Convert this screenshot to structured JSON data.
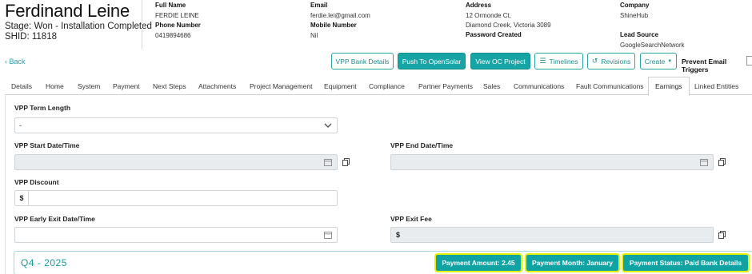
{
  "customer": {
    "name": "Ferdinand Leine",
    "stage": "Stage: Won - Installation Completed",
    "shid": "SHID: 11818"
  },
  "details": {
    "full_name_label": "Full Name",
    "full_name": "FERDIE LEINE",
    "phone_label": "Phone Number",
    "phone": "0419894686",
    "email_label": "Email",
    "email": "ferdie.lei@gmail.com",
    "mobile_label": "Mobile Number",
    "mobile": "Nil",
    "address_label": "Address",
    "address_line1": "12 Ormonde Ct,",
    "address_line2": "Diamond Creek, Victoria 3089",
    "password_label": "Password Created",
    "company_label": "Company",
    "company": "ShineHub",
    "lead_source_label": "Lead Source",
    "lead_source": "GoogleSearchNetwork"
  },
  "toolbar": {
    "back": "Back",
    "vpp_bank_details": "VPP Bank Details",
    "push_opensolar": "Push To OpenSolar",
    "view_oc_project": "View OC Project",
    "timelines": "Timelines",
    "revisions": "Revisions",
    "create": "Create",
    "prevent_email_triggers": "Prevent Email Triggers"
  },
  "tabs": [
    {
      "label": "Details"
    },
    {
      "label": "Home"
    },
    {
      "label": "System"
    },
    {
      "label": "Payment"
    },
    {
      "label": "Next Steps"
    },
    {
      "label": "Attachments"
    },
    {
      "label": "Project Management"
    },
    {
      "label": "Equipment"
    },
    {
      "label": "Compliance"
    },
    {
      "label": "Partner Payments"
    },
    {
      "label": "Sales"
    },
    {
      "label": "Communications"
    },
    {
      "label": "Fault Communications"
    },
    {
      "label": "Earnings",
      "active": true
    },
    {
      "label": "Linked Entities"
    }
  ],
  "form": {
    "vpp_term_label": "VPP Term Length",
    "vpp_term_value": "-",
    "vpp_start_label": "VPP Start Date/Time",
    "vpp_end_label": "VPP End Date/Time",
    "vpp_discount_label": "VPP Discount",
    "currency_symbol": "$",
    "vpp_early_exit_label": "VPP Early Exit Date/Time",
    "vpp_exit_fee_label": "VPP Exit Fee"
  },
  "earnings": {
    "quarter": "Q4 - 2025",
    "payment_amount": "Payment Amount: 2.45",
    "payment_month": "Payment Month: January",
    "payment_status": "Payment Status: Paid Bank Details"
  },
  "colors": {
    "accent": "#16a4a4",
    "highlight": "#e6f000",
    "link": "#2a9fb0"
  }
}
